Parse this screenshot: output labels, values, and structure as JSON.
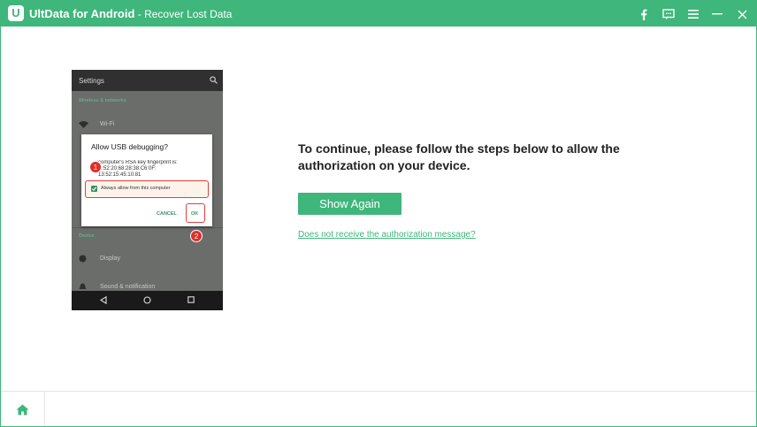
{
  "titlebar": {
    "logo_letter": "U",
    "app_name": "UltData for Android",
    "subtitle": " - Recover Lost Data"
  },
  "phone": {
    "screen_title": "Settings",
    "section_wireless": "Wireless & networks",
    "row_wifi": "Wi-Fi",
    "section_device": "Device",
    "row_display": "Display",
    "row_sound": "Sound & notification",
    "dialog": {
      "title": "Allow USB debugging?",
      "text_line1": "computer's RSA key fingerprint is:",
      "text_line2": "C:52:20:68:28:38:C6:0F:",
      "text_line3": "13:52:15:45:10:81",
      "checkbox_label": "Always allow from this computer",
      "cancel_label": "CANCEL",
      "ok_label": "OK"
    },
    "badge_1": "1",
    "badge_2": "2"
  },
  "main": {
    "instruction": "To continue, please follow the steps below to allow the authorization on your device.",
    "show_again_label": "Show Again",
    "help_link": "Does not receive the authorization message?"
  },
  "colors": {
    "accent": "#3fb67b",
    "highlight_red": "#e2403c"
  },
  "icons": {
    "titlebar": [
      "facebook-icon",
      "feedback-icon",
      "menu-icon",
      "minimize-icon",
      "close-icon"
    ],
    "bottom": [
      "home-icon"
    ]
  }
}
